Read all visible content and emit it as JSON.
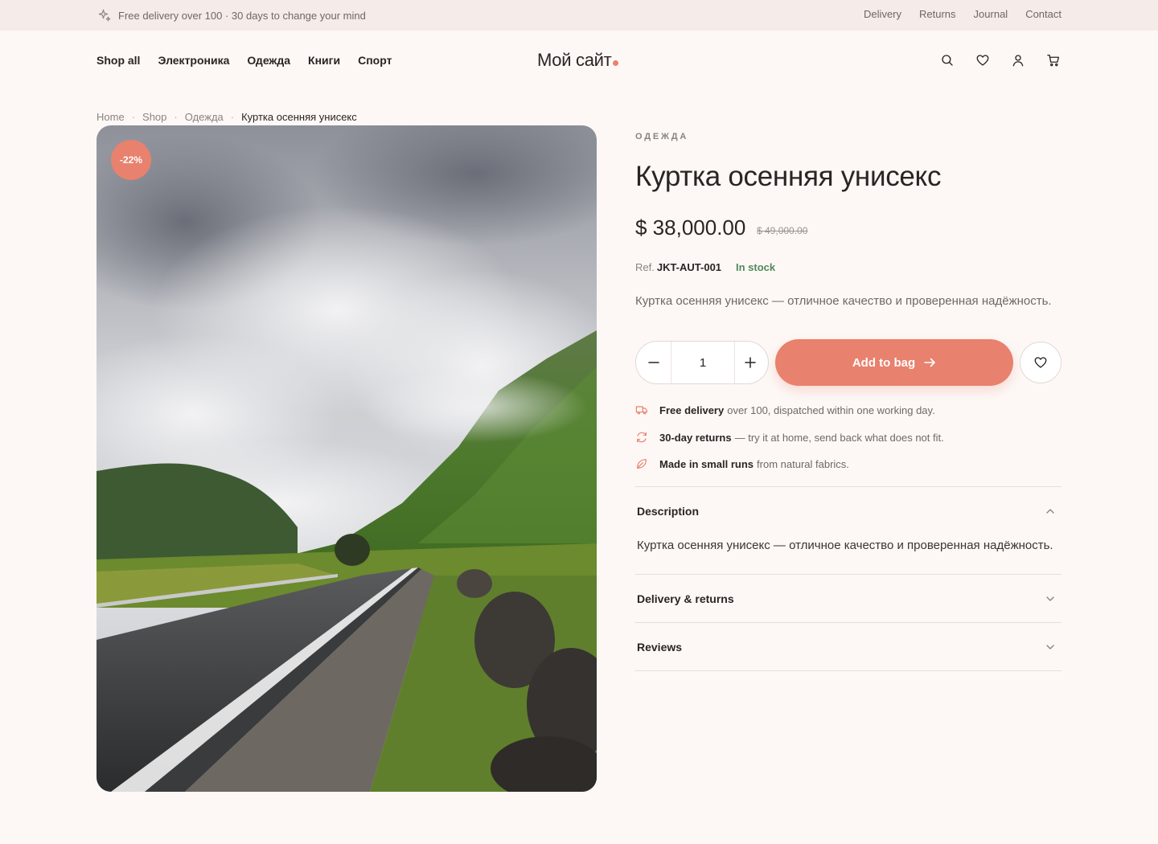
{
  "topbar": {
    "promo": "Free delivery over 100 · 30 days to change your mind",
    "links": [
      "Delivery",
      "Returns",
      "Journal",
      "Contact"
    ]
  },
  "header": {
    "nav": [
      "Shop all",
      "Электроника",
      "Одежда",
      "Книги",
      "Спорт"
    ],
    "logo": "Мой сайт",
    "icons": [
      "search-icon",
      "heart-icon",
      "user-icon",
      "cart-icon"
    ]
  },
  "breadcrumb": {
    "items": [
      "Home",
      "Shop",
      "Одежда"
    ],
    "current": "Куртка осенняя унисекс",
    "separator": "·"
  },
  "product": {
    "badge": "-22%",
    "category": "ОДЕЖДА",
    "title": "Куртка осенняя унисекс",
    "price": "$ 38,000.00",
    "old_price": "$ 49,000.00",
    "ref_label": "Ref.",
    "ref": "JKT-AUT-001",
    "stock": "In stock",
    "short_description": "Куртка осенняя унисекс — отличное качество и проверенная надёжность.",
    "quantity": "1",
    "add_to_bag": "Add to bag"
  },
  "perks": [
    {
      "bold": "Free delivery",
      "text": "over 100, dispatched within one working day.",
      "icon": "truck-icon"
    },
    {
      "bold": "30-day returns",
      "text": "— try it at home, send back what does not fit.",
      "icon": "refresh-icon"
    },
    {
      "bold": "Made in small runs",
      "text": "from natural fabrics.",
      "icon": "leaf-icon"
    }
  ],
  "accordion": {
    "description_label": "Description",
    "description_text": "Куртка осенняя унисекс — отличное качество и проверенная надёжность.",
    "delivery_label": "Delivery & returns",
    "reviews_label": "Reviews"
  },
  "colors": {
    "accent": "#e8816d",
    "background": "#fdf8f6",
    "topbar": "#f5ebe8",
    "in_stock": "#4f8a5b"
  }
}
